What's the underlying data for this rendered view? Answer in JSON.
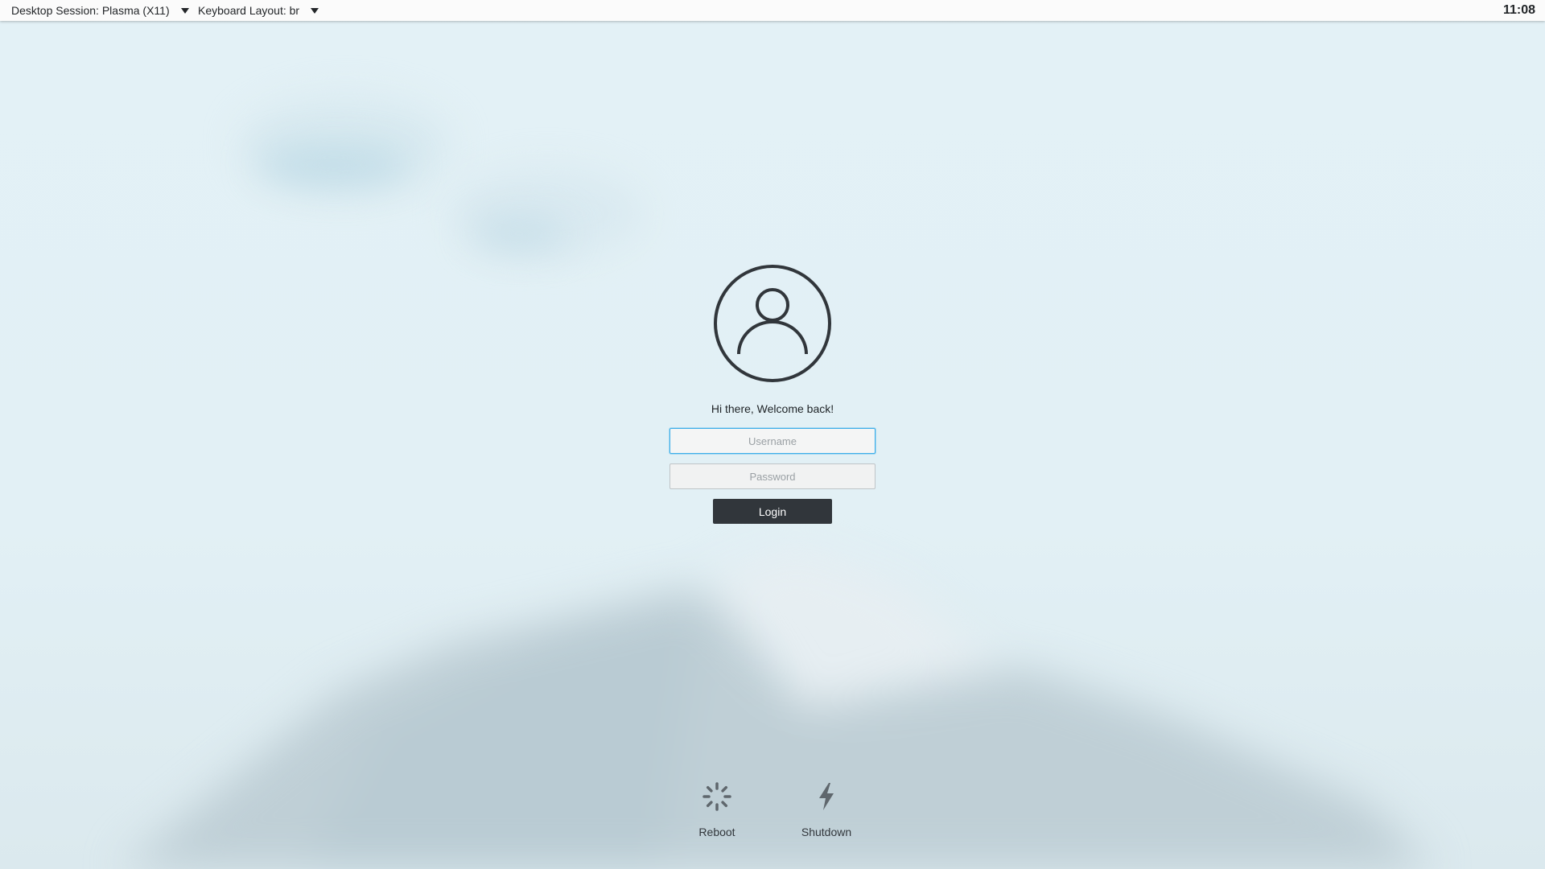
{
  "topbar": {
    "session_label": "Desktop Session: Plasma (X11)",
    "keyboard_label": "Keyboard Layout: br",
    "clock": "11:08"
  },
  "login": {
    "greeting": "Hi there, Welcome back!",
    "username_placeholder": "Username",
    "password_placeholder": "Password",
    "login_label": "Login"
  },
  "actions": {
    "reboot_label": "Reboot",
    "shutdown_label": "Shutdown"
  },
  "icons": {
    "avatar": "user-avatar-icon",
    "reboot": "reboot-spinner-icon",
    "shutdown": "lightning-bolt-icon",
    "dropdown": "caret-down-icon"
  },
  "colors": {
    "accent": "#3daee9",
    "button": "#31363b",
    "background": "#e2f0f5"
  }
}
